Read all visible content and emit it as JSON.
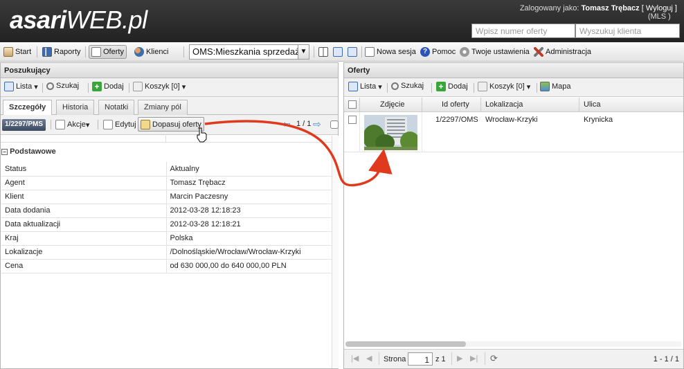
{
  "header": {
    "logo_bold": "asari",
    "logo_rest": "WEB.pl",
    "login_prefix": "Zalogowany jako:",
    "user_name": "Tomasz Trębacz",
    "logout": "[ Wyloguj ]",
    "mls": "(MLS  )",
    "offer_number_placeholder": "Wpisz numer oferty",
    "client_search_placeholder": "Wyszukuj klienta"
  },
  "toolbar": {
    "start": "Start",
    "raporty": "Raporty",
    "oferty": "Oferty",
    "klienci": "Klienci",
    "select_value": "OMS:Mieszkania sprzedaż",
    "nowa_sesja": "Nowa sesja",
    "pomoc": "Pomoc",
    "ustawienia": "Twoje ustawienia",
    "administracja": "Administracja"
  },
  "left": {
    "title": "Poszukujący",
    "toolbar": {
      "lista": "Lista",
      "szukaj": "Szukaj",
      "dodaj": "Dodaj",
      "koszyk": "Koszyk [0]"
    },
    "tabs": [
      "Szczegóły",
      "Historia",
      "Notatki",
      "Zmiany pól"
    ],
    "record_id": "1/2297/PMS",
    "akcje": "Akcje",
    "edytuj": "Edytuj",
    "dopasuj": "Dopasuj oferty",
    "nav": "1 / 1",
    "section": "Podstawowe",
    "rows": [
      {
        "k": "Status",
        "v": "Aktualny"
      },
      {
        "k": "Agent",
        "v": "Tomasz Trębacz"
      },
      {
        "k": "Klient",
        "v": "Marcin Paczesny"
      },
      {
        "k": "Data dodania",
        "v": "2012-03-28 12:18:23"
      },
      {
        "k": "Data aktualizacji",
        "v": "2012-03-28 12:18:21"
      },
      {
        "k": "Kraj",
        "v": "Polska"
      },
      {
        "k": "Lokalizacje",
        "v": "/Dolnośląskie/Wrocław/Wrocław-Krzyki"
      },
      {
        "k": "Cena",
        "v": "od 630 000,00 do 640 000,00 PLN"
      }
    ]
  },
  "right": {
    "title": "Oferty",
    "toolbar": {
      "lista": "Lista",
      "szukaj": "Szukaj",
      "dodaj": "Dodaj",
      "koszyk": "Koszyk [0]",
      "mapa": "Mapa"
    },
    "columns": [
      "Zdjęcie",
      "Id oferty",
      "Lokalizacja",
      "Ulica"
    ],
    "rows": [
      {
        "id": "1/2297/OMS",
        "lokalizacja": "Wrocław-Krzyki",
        "ulica": "Krynicka"
      }
    ],
    "pager": {
      "strona_label": "Strona",
      "page": "1",
      "of": "z 1",
      "range": "1 - 1 / 1"
    }
  },
  "colors": {
    "header_bg": "#2b2b2b",
    "arrow": "#e03a1e",
    "badge": "#4a5a70"
  }
}
